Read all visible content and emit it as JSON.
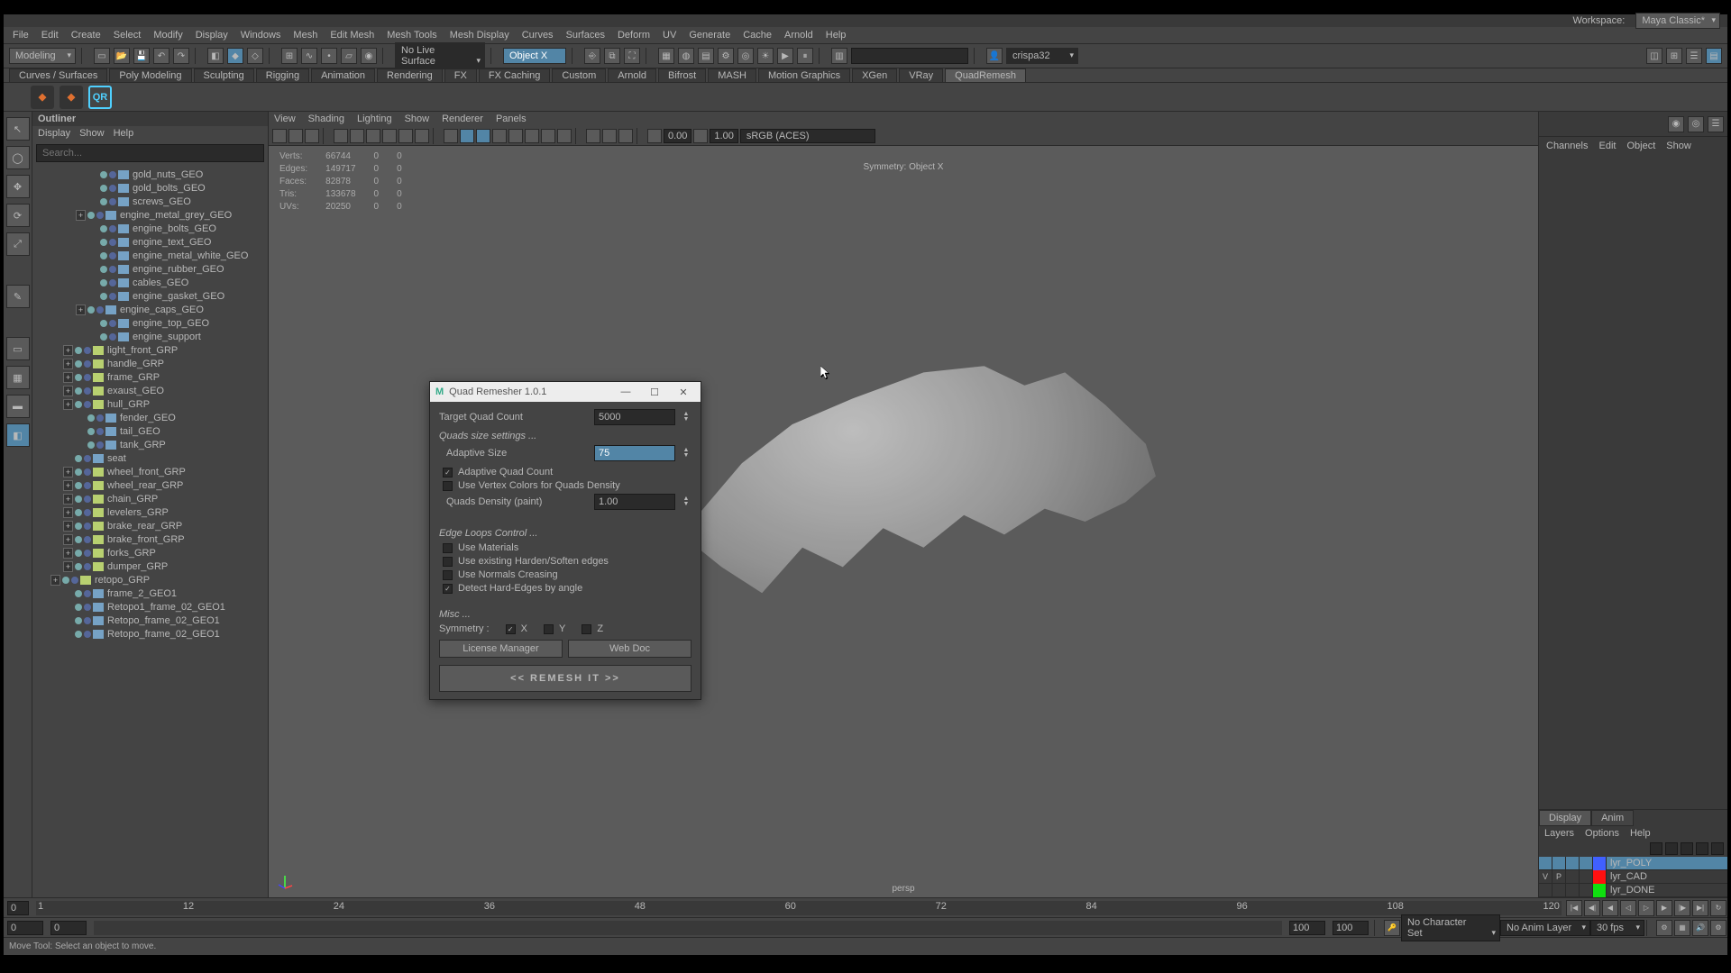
{
  "workspace": {
    "label": "Workspace:",
    "value": "Maya Classic*"
  },
  "menubar": [
    "File",
    "Edit",
    "Create",
    "Select",
    "Modify",
    "Display",
    "Windows",
    "Mesh",
    "Edit Mesh",
    "Mesh Tools",
    "Mesh Display",
    "Curves",
    "Surfaces",
    "Deform",
    "UV",
    "Generate",
    "Cache",
    "Arnold",
    "Help"
  ],
  "status": {
    "mode": "Modeling",
    "live_surface": "No Live Surface",
    "symmetry": "Object X",
    "account": "crispa32"
  },
  "shelves": [
    "Curves / Surfaces",
    "Poly Modeling",
    "Sculpting",
    "Rigging",
    "Animation",
    "Rendering",
    "FX",
    "FX Caching",
    "Custom",
    "Arnold",
    "Bifrost",
    "MASH",
    "Motion Graphics",
    "XGen",
    "VRay",
    "QuadRemesh"
  ],
  "shelf_active_index": 15,
  "shelf_icons": [
    {
      "fg": "#e07030",
      "bg": "#333"
    },
    {
      "fg": "#e07030",
      "bg": "#333"
    },
    {
      "txt": "QR",
      "fg": "#4fd0ff",
      "border": "#4fd0ff"
    }
  ],
  "outliner": {
    "title": "Outliner",
    "menu": [
      "Display",
      "Show",
      "Help"
    ],
    "search_placeholder": "Search...",
    "items": [
      {
        "indent": 4,
        "exp": "",
        "dot": "#7aa",
        "shape": "#76a2c5",
        "name": "gold_nuts_GEO"
      },
      {
        "indent": 4,
        "exp": "",
        "dot": "#7aa",
        "shape": "#76a2c5",
        "name": "gold_bolts_GEO"
      },
      {
        "indent": 4,
        "exp": "",
        "dot": "#7aa",
        "shape": "#76a2c5",
        "name": "screws_GEO"
      },
      {
        "indent": 3,
        "exp": "+",
        "dot": "#7aa",
        "shape": "#76a2c5",
        "name": "engine_metal_grey_GEO"
      },
      {
        "indent": 4,
        "exp": "",
        "dot": "#7aa",
        "shape": "#76a2c5",
        "name": "engine_bolts_GEO"
      },
      {
        "indent": 4,
        "exp": "",
        "dot": "#7aa",
        "shape": "#76a2c5",
        "name": "engine_text_GEO"
      },
      {
        "indent": 4,
        "exp": "",
        "dot": "#7aa",
        "shape": "#76a2c5",
        "name": "engine_metal_white_GEO"
      },
      {
        "indent": 4,
        "exp": "",
        "dot": "#7aa",
        "shape": "#76a2c5",
        "name": "engine_rubber_GEO"
      },
      {
        "indent": 4,
        "exp": "",
        "dot": "#7aa",
        "shape": "#76a2c5",
        "name": "cables_GEO"
      },
      {
        "indent": 4,
        "exp": "",
        "dot": "#7aa",
        "shape": "#76a2c5",
        "name": "engine_gasket_GEO"
      },
      {
        "indent": 3,
        "exp": "+",
        "dot": "#7aa",
        "shape": "#76a2c5",
        "name": "engine_caps_GEO"
      },
      {
        "indent": 4,
        "exp": "",
        "dot": "#7aa",
        "shape": "#76a2c5",
        "name": "engine_top_GEO"
      },
      {
        "indent": 4,
        "exp": "",
        "dot": "#7aa",
        "shape": "#76a2c5",
        "name": "engine_support"
      },
      {
        "indent": 2,
        "exp": "+",
        "dot": "#7aa",
        "shape": "#b8d070",
        "name": "light_front_GRP"
      },
      {
        "indent": 2,
        "exp": "+",
        "dot": "#7aa",
        "shape": "#b8d070",
        "name": "handle_GRP"
      },
      {
        "indent": 2,
        "exp": "+",
        "dot": "#7aa",
        "shape": "#b8d070",
        "name": "frame_GRP"
      },
      {
        "indent": 2,
        "exp": "+",
        "dot": "#7aa",
        "shape": "#b8d070",
        "name": "exaust_GEO"
      },
      {
        "indent": 2,
        "exp": "+",
        "dot": "#7aa",
        "shape": "#b8d070",
        "name": "hull_GRP"
      },
      {
        "indent": 3,
        "exp": "",
        "dot": "#7aa",
        "shape": "#76a2c5",
        "name": "fender_GEO"
      },
      {
        "indent": 3,
        "exp": "",
        "dot": "#7aa",
        "shape": "#76a2c5",
        "name": "tail_GEO"
      },
      {
        "indent": 3,
        "exp": "",
        "dot": "#7aa",
        "shape": "#76a2c5",
        "name": "tank_GRP"
      },
      {
        "indent": 2,
        "exp": "",
        "dot": "#7aa",
        "shape": "#76a2c5",
        "name": "seat"
      },
      {
        "indent": 2,
        "exp": "+",
        "dot": "#7aa",
        "shape": "#b8d070",
        "name": "wheel_front_GRP"
      },
      {
        "indent": 2,
        "exp": "+",
        "dot": "#7aa",
        "shape": "#b8d070",
        "name": "wheel_rear_GRP"
      },
      {
        "indent": 2,
        "exp": "+",
        "dot": "#7aa",
        "shape": "#b8d070",
        "name": "chain_GRP"
      },
      {
        "indent": 2,
        "exp": "+",
        "dot": "#7aa",
        "shape": "#b8d070",
        "name": "levelers_GRP"
      },
      {
        "indent": 2,
        "exp": "+",
        "dot": "#7aa",
        "shape": "#b8d070",
        "name": "brake_rear_GRP"
      },
      {
        "indent": 2,
        "exp": "+",
        "dot": "#7aa",
        "shape": "#b8d070",
        "name": "brake_front_GRP"
      },
      {
        "indent": 2,
        "exp": "+",
        "dot": "#7aa",
        "shape": "#b8d070",
        "name": "forks_GRP"
      },
      {
        "indent": 2,
        "exp": "+",
        "dot": "#7aa",
        "shape": "#b8d070",
        "name": "dumper_GRP"
      },
      {
        "indent": 1,
        "exp": "+",
        "dot": "#7aa",
        "shape": "#b8d070",
        "name": "retopo_GRP"
      },
      {
        "indent": 2,
        "exp": "",
        "dot": "#7aa",
        "shape": "#76a2c5",
        "name": "frame_2_GEO1"
      },
      {
        "indent": 2,
        "exp": "",
        "dot": "#7aa",
        "shape": "#76a2c5",
        "name": "Retopo1_frame_02_GEO1"
      },
      {
        "indent": 2,
        "exp": "",
        "dot": "#7aa",
        "shape": "#76a2c5",
        "name": "Retopo_frame_02_GEO1"
      },
      {
        "indent": 2,
        "exp": "",
        "dot": "#7aa",
        "shape": "#76a2c5",
        "name": "Retopo_frame_02_GEO1"
      }
    ]
  },
  "viewport": {
    "menu": [
      "View",
      "Shading",
      "Lighting",
      "Show",
      "Renderer",
      "Panels"
    ],
    "num1": "0.00",
    "num2": "1.00",
    "colorspace": "sRGB (ACES)",
    "hud": {
      "rows": [
        {
          "label": "Verts:",
          "a": "66744",
          "b": "0",
          "c": "0"
        },
        {
          "label": "Edges:",
          "a": "149717",
          "b": "0",
          "c": "0"
        },
        {
          "label": "Faces:",
          "a": "82878",
          "b": "0",
          "c": "0"
        },
        {
          "label": "Tris:",
          "a": "133678",
          "b": "0",
          "c": "0"
        },
        {
          "label": "UVs:",
          "a": "20250",
          "b": "0",
          "c": "0"
        }
      ]
    },
    "hud_sym": "Symmetry: Object X",
    "camera": "persp"
  },
  "channels": {
    "menu": [
      "Channels",
      "Edit",
      "Object",
      "Show"
    ],
    "tabs": [
      "Display",
      "Anim"
    ],
    "active_tab": 0,
    "layer_menu": [
      "Layers",
      "Options",
      "Help"
    ],
    "layers": [
      {
        "v": "",
        "p": "",
        "col": "#4060ff",
        "name": "lyr_POLY",
        "sel": true
      },
      {
        "v": "V",
        "p": "P",
        "col": "#ff1010",
        "name": "lyr_CAD",
        "sel": false
      },
      {
        "v": "",
        "p": "",
        "col": "#10e010",
        "name": "lyr_DONE",
        "sel": false
      }
    ]
  },
  "timeline": {
    "ticks": [
      "1",
      "12",
      "24",
      "36",
      "48",
      "60",
      "72",
      "84",
      "96",
      "108",
      "120"
    ],
    "cur": "0",
    "start": "0",
    "vstart": "0",
    "vend": "100",
    "end": "100"
  },
  "bottombar": {
    "charset": "No Character Set",
    "animlayer": "No Anim Layer",
    "fps": "30 fps"
  },
  "hint": "Move Tool: Select an object to move.",
  "qr": {
    "title": "Quad Remesher 1.0.1",
    "target_label": "Target Quad Count",
    "target_value": "5000",
    "quads_size": "Quads size settings ...",
    "adapt_size_label": "Adaptive Size",
    "adapt_size_value": "75",
    "adaptive_quad": "Adaptive Quad Count",
    "vertex_colors": "Use Vertex Colors for Quads Density",
    "density_label": "Quads Density (paint)",
    "density_value": "1.00",
    "edge_loops": "Edge Loops Control ...",
    "use_mat": "Use Materials",
    "use_harden": "Use existing Harden/Soften edges",
    "use_normals": "Use Normals Creasing",
    "detect_hard": "Detect Hard-Edges by angle",
    "misc": "Misc ...",
    "sym_label": "Symmetry :",
    "sym_x": "X",
    "sym_y": "Y",
    "sym_z": "Z",
    "license": "License Manager",
    "webdoc": "Web Doc",
    "remesh": "<<   REMESH IT   >>"
  }
}
